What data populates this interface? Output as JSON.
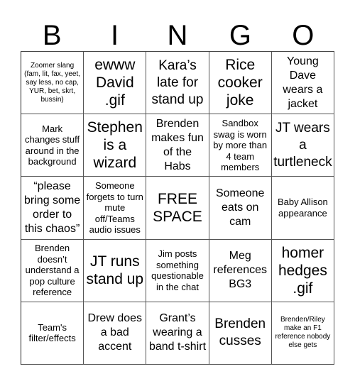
{
  "header": [
    "B",
    "I",
    "N",
    "G",
    "O"
  ],
  "cells": [
    {
      "text": "Zoomer slang (fam, lit, fax, yeet, say less, no cap, YUR, bet, skrt, bussin)",
      "size": "xs"
    },
    {
      "text": "ewww David .gif",
      "size": "xl"
    },
    {
      "text": "Kara’s late for stand up",
      "size": "lg"
    },
    {
      "text": "Rice cooker joke",
      "size": "xl"
    },
    {
      "text": "Young Dave wears a jacket",
      "size": "md"
    },
    {
      "text": "Mark changes stuff around in the background",
      "size": "sm"
    },
    {
      "text": "Stephen is a wizard",
      "size": "xl"
    },
    {
      "text": "Brenden makes fun of the Habs",
      "size": "md"
    },
    {
      "text": "Sandbox swag is worn by more than 4 team members",
      "size": "sm"
    },
    {
      "text": "JT wears a turtleneck",
      "size": "lg"
    },
    {
      "text": "“please bring some order to this chaos”",
      "size": "md"
    },
    {
      "text": "Someone forgets to turn mute off/Teams audio issues",
      "size": "sm"
    },
    {
      "text": "FREE SPACE",
      "size": "xl"
    },
    {
      "text": "Someone eats on cam",
      "size": "md"
    },
    {
      "text": "Baby Allison appearance",
      "size": "sm"
    },
    {
      "text": "Brenden doesn’t understand a pop culture reference",
      "size": "sm"
    },
    {
      "text": "JT runs stand up",
      "size": "xl"
    },
    {
      "text": "Jim posts something questionable in the chat",
      "size": "sm"
    },
    {
      "text": "Meg references BG3",
      "size": "md"
    },
    {
      "text": "homer hedges .gif",
      "size": "xl"
    },
    {
      "text": "Team's filter/effects",
      "size": "sm"
    },
    {
      "text": "Drew does a bad accent",
      "size": "md"
    },
    {
      "text": "Grant’s wearing a band t-shirt",
      "size": "md"
    },
    {
      "text": "Brenden cusses",
      "size": "lg"
    },
    {
      "text": "Brenden/Riley make an F1 reference nobody else gets",
      "size": "xs"
    }
  ]
}
